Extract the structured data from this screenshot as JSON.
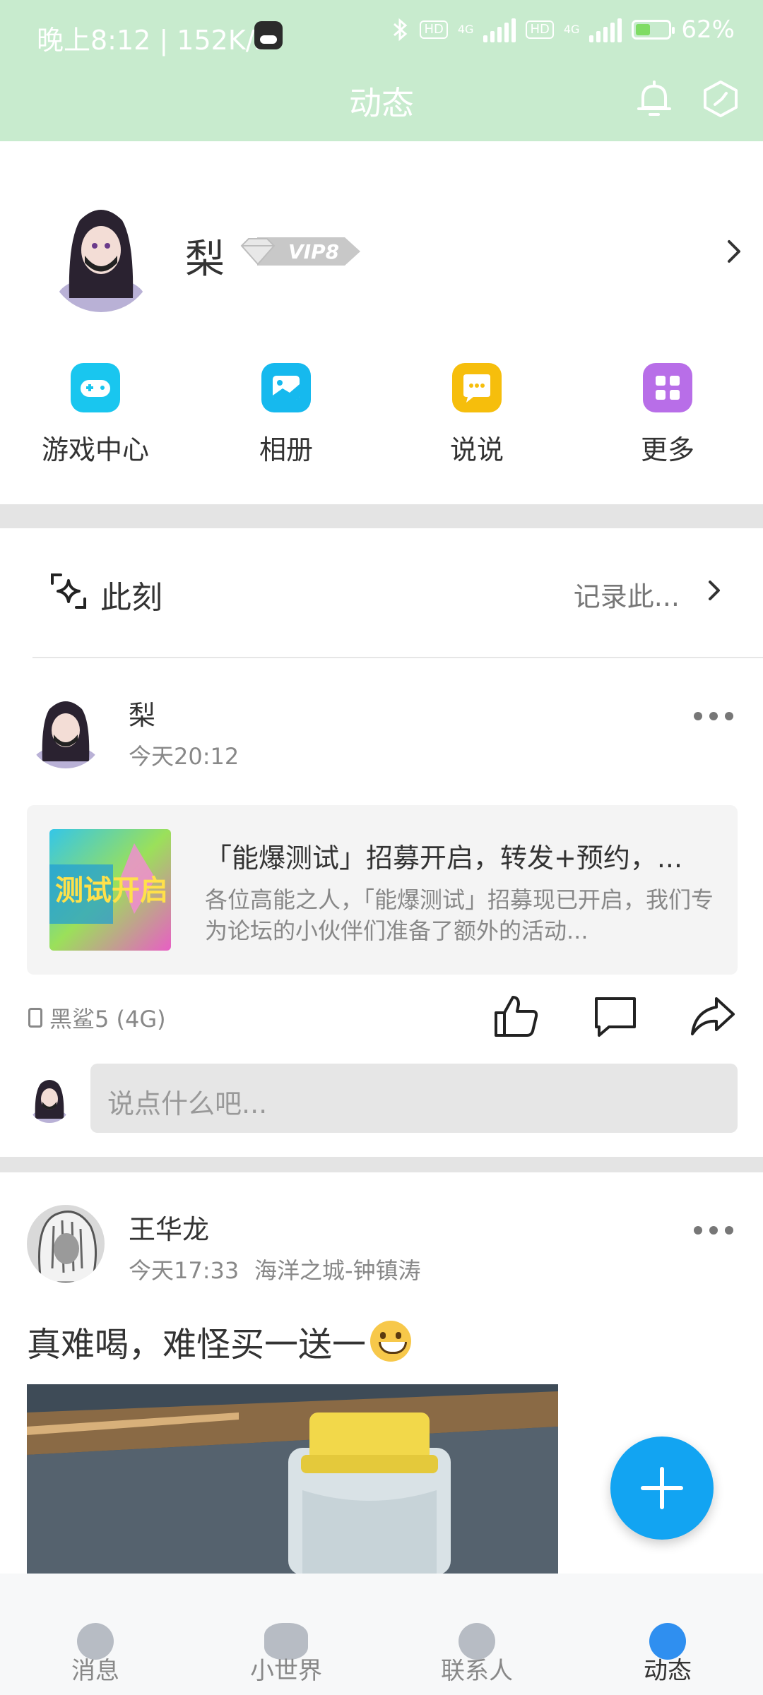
{
  "status_bar": {
    "time_speed": "晚上8:12 | 152K/s",
    "network_1": "4G",
    "network_2": "4G",
    "hd": "HD",
    "battery": "62%"
  },
  "header": {
    "title": "动态"
  },
  "profile": {
    "name": "梨",
    "vip_label": "VIP8"
  },
  "quick_actions": [
    {
      "label": "游戏中心",
      "icon": "gamepad-icon",
      "color": "#19c6ef"
    },
    {
      "label": "相册",
      "icon": "photo-album-icon",
      "color": "#16b9ee"
    },
    {
      "label": "说说",
      "icon": "chat-bubble-icon",
      "color": "#f6be0c"
    },
    {
      "label": "更多",
      "icon": "grid-icon",
      "color": "#b86ee8"
    }
  ],
  "moment": {
    "label": "此刻",
    "action": "记录此..."
  },
  "posts": [
    {
      "author": "梨",
      "time": "今天20:12",
      "share": {
        "title": "「能爆测试」招募开启，转发+预约，...",
        "desc": "各位高能之人，「能爆测试」招募现已开启，我们专为论坛的小伙伴们准备了额外的活动...",
        "thumb_text": "测试开启"
      },
      "device": "黑鲨5 (4G)",
      "comment_placeholder": "说点什么吧..."
    },
    {
      "author": "王华龙",
      "time": "今天17:33",
      "location": "海洋之城-钟镇涛",
      "text": "真难喝，难怪买一送一"
    }
  ],
  "bottom_nav": [
    {
      "label": "消息",
      "active": false
    },
    {
      "label": "小世界",
      "active": false
    },
    {
      "label": "联系人",
      "active": false
    },
    {
      "label": "动态",
      "active": true
    }
  ],
  "colors": {
    "header_bg": "#c8ebce",
    "accent": "#12a4f2"
  }
}
